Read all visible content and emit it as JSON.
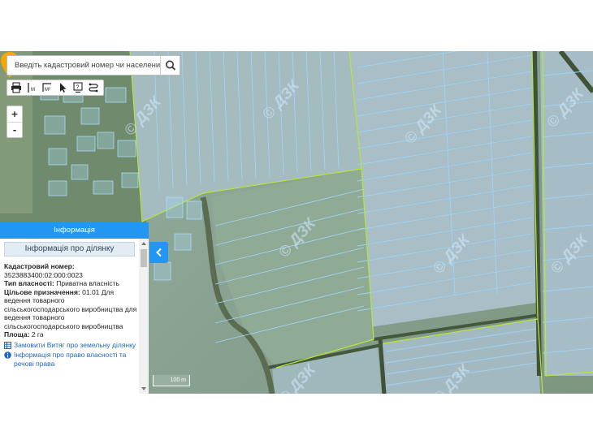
{
  "search": {
    "placeholder": "Введіть кадастровий номер чи населений",
    "button_icon": "search-icon"
  },
  "toolbar": {
    "tools": [
      "print-icon",
      "measure-line-icon",
      "measure-area-icon",
      "pointer-icon",
      "help-icon",
      "route-icon"
    ]
  },
  "zoom": {
    "in_label": "+",
    "out_label": "-"
  },
  "map": {
    "watermark_text": "© ДЗК",
    "scale_label": "100 m",
    "marker_color": "#f5a800",
    "parcel_line_color": "#9fd3f5",
    "boundary_color": "#b8e63a"
  },
  "panel": {
    "header": "Інформація",
    "title": "Інформація про ділянку",
    "cadastral_label": "Кадастровий номер:",
    "cadastral_value": "3523883400:02:000:0023",
    "ownership_label": "Тип власності:",
    "ownership_value": "Приватна власність",
    "purpose_label": "Цільове призначення:",
    "purpose_value": "01.01 Для ведення товарного сільськогосподарського виробництва для ведення товарного сільськогосподарського виробництва",
    "area_label": "Площа:",
    "area_value": "2 га",
    "link_extract": "Замовити Витяг про земельну ділянку",
    "link_rights": "Інформація про право власності та речові права"
  },
  "colors": {
    "accent": "#2196f3",
    "link": "#1e66c2"
  }
}
